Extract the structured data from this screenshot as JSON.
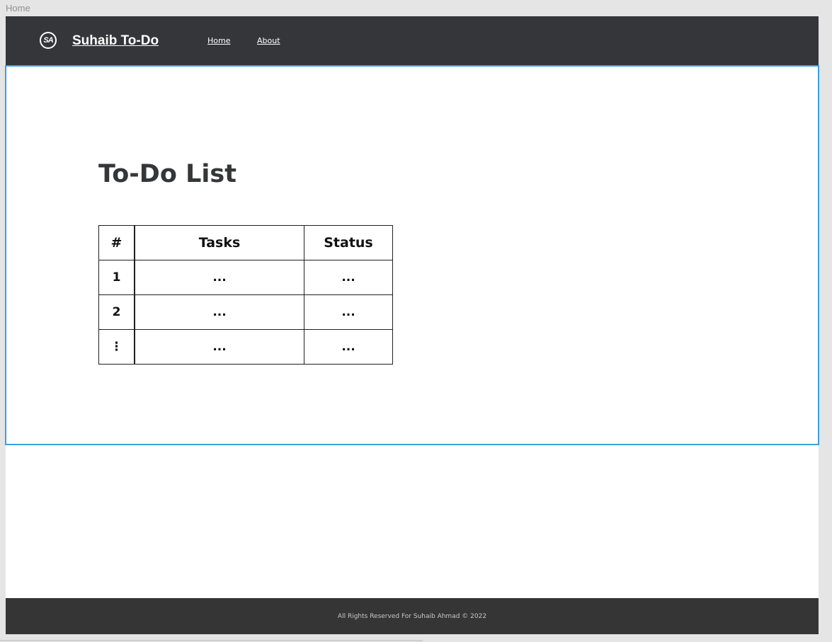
{
  "window": {
    "frame_label": "Home"
  },
  "navbar": {
    "logo_text": "SA",
    "brand": "Suhaib To-Do",
    "links": [
      "Home",
      "About"
    ]
  },
  "main": {
    "title": "To-Do List",
    "table": {
      "headers": [
        "#",
        "Tasks",
        "Status"
      ],
      "rows": [
        [
          "1",
          "...",
          "..."
        ],
        [
          "2",
          "...",
          "..."
        ],
        [
          "⋮",
          "...",
          "..."
        ]
      ]
    }
  },
  "footer": {
    "text": "All Rights Reserved For Suhaib Ahmad  © 2022"
  },
  "colors": {
    "navbar_bg": "#35363a",
    "footer_bg": "#353535",
    "selection_border": "#3aa0df",
    "title_text": "#35363a"
  }
}
